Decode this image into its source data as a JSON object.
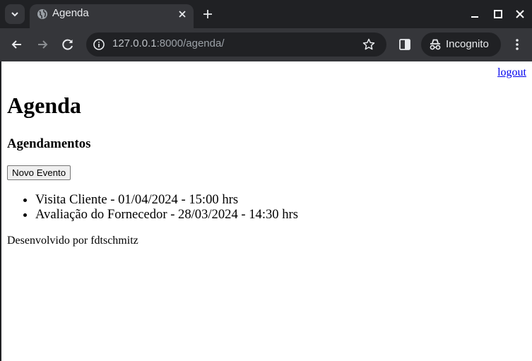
{
  "browser": {
    "tab_title": "Agenda",
    "url_host": "127.0.0.1",
    "url_path": ":8000/agenda/",
    "incognito_label": "Incognito",
    "icons": [
      "tab-search-icon",
      "globe-icon",
      "close-icon",
      "plus-icon",
      "minimize-icon",
      "maximize-icon",
      "window-close-icon",
      "back-arrow-icon",
      "forward-arrow-icon",
      "reload-icon",
      "site-info-icon",
      "star-icon",
      "side-panel-icon",
      "incognito-icon",
      "kebab-menu-icon"
    ],
    "colors": {
      "frame": "#202124",
      "toolbar": "#35363a",
      "text": "#e8eaed"
    }
  },
  "page": {
    "logout_label": "logout",
    "title": "Agenda",
    "subtitle": "Agendamentos",
    "new_event_label": "Novo Evento",
    "events": [
      {
        "text": "Visita Cliente - 01/04/2024 - 15:00 hrs"
      },
      {
        "text": "Avaliação do Fornecedor - 28/03/2024 - 14:30 hrs"
      }
    ],
    "footer": "Desenvolvido por fdtschmitz",
    "colors": {
      "link": "#0000ee"
    }
  }
}
